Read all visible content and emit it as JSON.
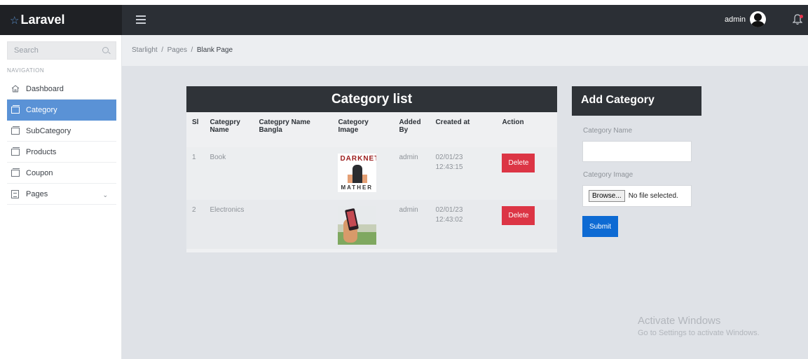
{
  "brand": {
    "name": "Laravel",
    "icon": "star-icon"
  },
  "header": {
    "menu_icon": "hamburger-icon",
    "user": "admin",
    "notification_icon": "bell-icon"
  },
  "sidebar": {
    "search_placeholder": "Search",
    "nav_label": "NAVIGATION",
    "items": [
      {
        "label": "Dashboard",
        "icon": "home-icon",
        "active": false
      },
      {
        "label": "Category",
        "icon": "window-icon",
        "active": true
      },
      {
        "label": "SubCategory",
        "icon": "window-icon",
        "active": false
      },
      {
        "label": "Products",
        "icon": "window-icon",
        "active": false
      },
      {
        "label": "Coupon",
        "icon": "window-icon",
        "active": false
      },
      {
        "label": "Pages",
        "icon": "page-icon",
        "active": false,
        "has_dropdown": true
      }
    ]
  },
  "breadcrumb": {
    "a": "Starlight",
    "b": "Pages",
    "current": "Blank Page",
    "separator": "/"
  },
  "category_list": {
    "title": "Category list",
    "headers": {
      "sl": "Sl",
      "name": "Categpry Name",
      "name_bangla": "Categpry Name Bangla",
      "image": "Category Image",
      "added_by": "Added By",
      "created_at": "Created at",
      "action": "Action"
    },
    "rows": [
      {
        "sl": "1",
        "name": "Book",
        "name_bangla": "",
        "image_top": "DARKNET",
        "image_bottom": "MATHER",
        "added_by": "admin",
        "created_date": "02/01/23",
        "created_time": "12:43:15",
        "action": "Delete"
      },
      {
        "sl": "2",
        "name": "Electronics",
        "name_bangla": "",
        "added_by": "admin",
        "created_date": "02/01/23",
        "created_time": "12:43:02",
        "action": "Delete"
      }
    ]
  },
  "add_category": {
    "title": "Add Category",
    "name_label": "Category Name",
    "image_label": "Category Image",
    "browse": "Browse...",
    "no_file": "No file selected.",
    "submit": "Submit"
  },
  "watermark": {
    "line1": "Activate Windows",
    "line2": "Go to Settings to activate Windows."
  },
  "colors": {
    "accent": "#5a92d6",
    "danger": "#dc3545",
    "primary": "#0d6ad3",
    "dark": "#2f3338"
  }
}
